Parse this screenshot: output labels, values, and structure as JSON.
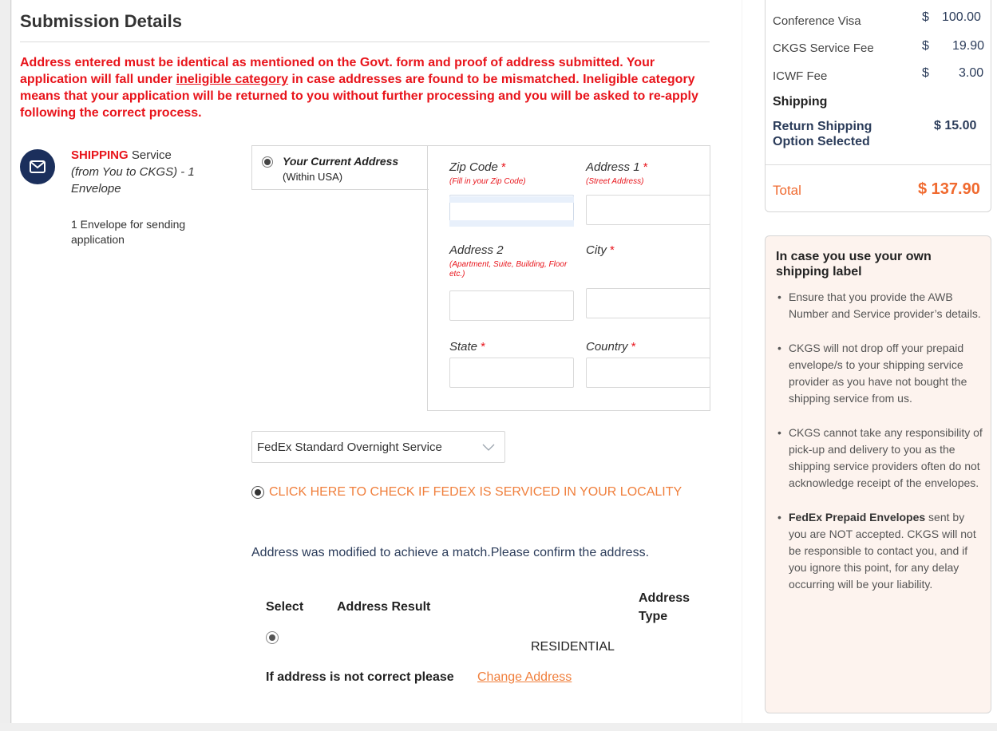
{
  "submission": {
    "title": "Submission Details",
    "warning_pre": "Address entered must be identical as mentioned on the Govt. form and proof of address submitted. Your application will fall under ",
    "warning_link": "ineligible category",
    "warning_post": " in case addresses are found to be mismatched. Ineligible category means that your application will be returned to you without further processing and you will be asked to re-apply following the correct process."
  },
  "shipping": {
    "title_red": "SHIPPING",
    "title_rest": " Service",
    "subtitle": "(from You to CKGS) - 1 Envelope",
    "note": "1 Envelope for sending application"
  },
  "address_tab": {
    "title": "Your Current Address",
    "subtitle": "(Within USA)"
  },
  "form": {
    "zip_label": "Zip Code",
    "zip_hint": "(Fill in your Zip Code)",
    "address1_label": "Address 1",
    "address1_hint": "(Street Address)",
    "address2_label": "Address 2",
    "address2_hint": "(Apartment, Suite, Building, Floor etc.)",
    "city_label": "City",
    "state_label": "State",
    "country_label": "Country",
    "required_mark": "*"
  },
  "service_select": {
    "selected": "FedEx Standard Overnight Service"
  },
  "fedex_check": {
    "label": "CLICK HERE TO CHECK IF FEDEX IS SERVICED IN YOUR LOCALITY"
  },
  "address_match": {
    "message": "Address was modified to achieve a match.Please confirm the address.",
    "col_select": "Select",
    "col_result": "Address Result",
    "col_type_1": "Address",
    "col_type_2": "Type",
    "row_type": "RESIDENTIAL",
    "incorrect_text": "If address is not correct please",
    "change_link": "Change Address"
  },
  "summary": {
    "items": [
      {
        "label": "Conference Visa",
        "currency": "$",
        "amount": "100.00"
      },
      {
        "label": "CKGS Service Fee",
        "currency": "$",
        "amount": "19.90"
      },
      {
        "label": "ICWF Fee",
        "currency": "$",
        "amount": "3.00"
      }
    ],
    "shipping_heading": "Shipping",
    "return_label": "Return Shipping Option Selected",
    "return_amount": "$ 15.00",
    "total_label": "Total",
    "total_amount": "$ 137.90"
  },
  "own_label": {
    "title": "In case you use your own shipping label",
    "tips": [
      {
        "bold": "",
        "text": "Ensure that you provide the AWB Number and Service provider’s details."
      },
      {
        "bold": "",
        "text": "CKGS will not drop off your prepaid envelope/s to your shipping service provider as you have not bought the shipping service from us."
      },
      {
        "bold": "",
        "text": "CKGS cannot take any responsibility of pick-up and delivery to you as the shipping service providers often do not acknowledge receipt of the envelopes."
      },
      {
        "bold": "FedEx Prepaid Envelopes",
        "text": " sent by you are NOT accepted. CKGS will not be responsible to contact you, and if you ignore this point, for any delay occurring will be your liability."
      }
    ]
  },
  "colors": {
    "warning_red": "#e8141b",
    "link_orange": "#f07f3c",
    "total_orange": "#f06a2f",
    "navy": "#1b2f5c",
    "tip_bg": "#fdf3ee"
  },
  "icons": {
    "shipping": "envelope-icon",
    "select_chevron": "chevron-down-icon"
  }
}
